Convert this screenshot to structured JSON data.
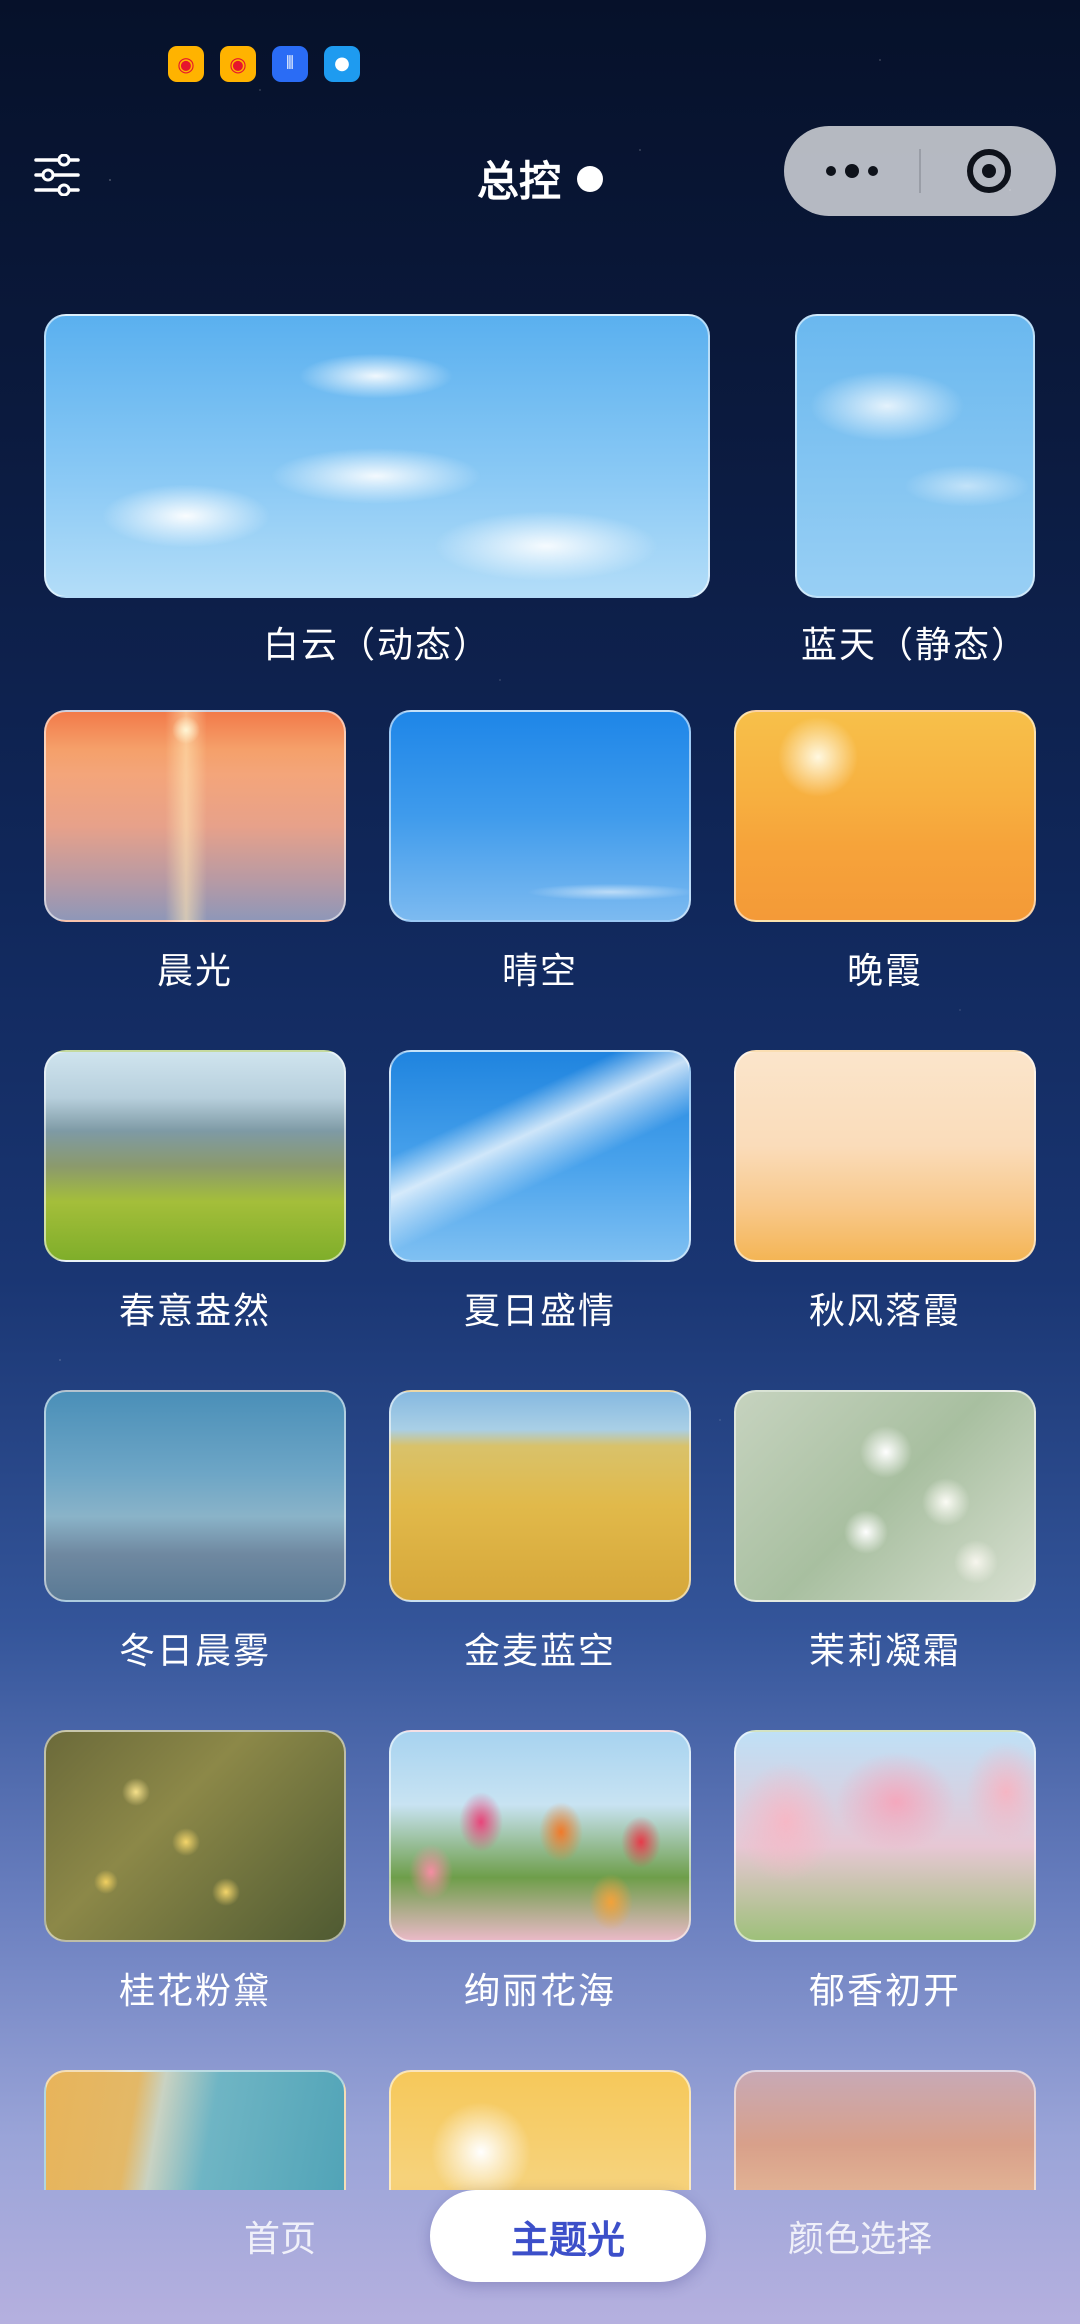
{
  "status_bar": {
    "icons": [
      "weibo-icon",
      "weibo-icon",
      "voice-icon",
      "message-icon"
    ]
  },
  "header": {
    "title": "总控",
    "filter_icon": "sliders-icon",
    "capsule": {
      "more_icon": "more-dots-icon",
      "close_icon": "target-icon"
    }
  },
  "themes": [
    {
      "label": "白云（动态）"
    },
    {
      "label": "蓝天（静态）"
    },
    {
      "label": "晨光"
    },
    {
      "label": "晴空"
    },
    {
      "label": "晚霞"
    },
    {
      "label": "春意盎然"
    },
    {
      "label": "夏日盛情"
    },
    {
      "label": "秋风落霞"
    },
    {
      "label": "冬日晨雾"
    },
    {
      "label": "金麦蓝空"
    },
    {
      "label": "茉莉凝霜"
    },
    {
      "label": "桂花粉黛"
    },
    {
      "label": "绚丽花海"
    },
    {
      "label": "郁香初开"
    }
  ],
  "bottom_nav": {
    "home": "首页",
    "theme_light": "主题光",
    "color_select": "颜色选择",
    "active": "主题光"
  }
}
